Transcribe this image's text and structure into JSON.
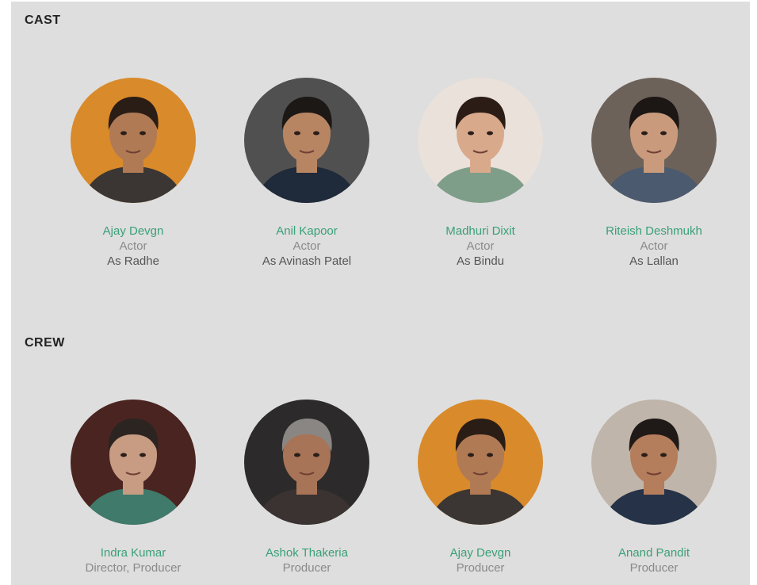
{
  "cast": {
    "title": "CAST",
    "people": [
      {
        "name": "Ajay Devgn",
        "role": "Actor",
        "character": "As Radhe",
        "avatar_bg": "#d98a2a",
        "skin": "#b07a55",
        "hair": "#2a1d16",
        "shirt": "#3b3633"
      },
      {
        "name": "Anil Kapoor",
        "role": "Actor",
        "character": "As Avinash Patel",
        "avatar_bg": "#505050",
        "skin": "#b88563",
        "hair": "#1c1816",
        "shirt": "#1f2a3a"
      },
      {
        "name": "Madhuri Dixit",
        "role": "Actor",
        "character": "As Bindu",
        "avatar_bg": "#e9e1da",
        "skin": "#d9a98c",
        "hair": "#2b1c16",
        "shirt": "#7e9e8a"
      },
      {
        "name": "Riteish Deshmukh",
        "role": "Actor",
        "character": "As Lallan",
        "avatar_bg": "#6d625a",
        "skin": "#c99b7c",
        "hair": "#1c1614",
        "shirt": "#4b5a6e"
      }
    ]
  },
  "crew": {
    "title": "CREW",
    "people": [
      {
        "name": "Indra Kumar",
        "role": "Director, Producer",
        "avatar_bg": "#4a2420",
        "skin": "#c79c83",
        "hair": "#2c2421",
        "shirt": "#3f7a6a"
      },
      {
        "name": "Ashok Thakeria",
        "role": "Producer",
        "avatar_bg": "#2c2a2a",
        "skin": "#a87457",
        "hair": "#8a8683",
        "shirt": "#3a3331"
      },
      {
        "name": "Ajay Devgn",
        "role": "Producer",
        "avatar_bg": "#d98a2a",
        "skin": "#b07a55",
        "hair": "#2a1d16",
        "shirt": "#3b3633"
      },
      {
        "name": "Anand Pandit",
        "role": "Producer",
        "avatar_bg": "#c0b5aa",
        "skin": "#b47d5c",
        "hair": "#1f1a18",
        "shirt": "#263247"
      }
    ]
  },
  "colors": {
    "panel_bg": "#dedede",
    "name_color": "#3aa077",
    "role_color": "#8a8a8a"
  }
}
